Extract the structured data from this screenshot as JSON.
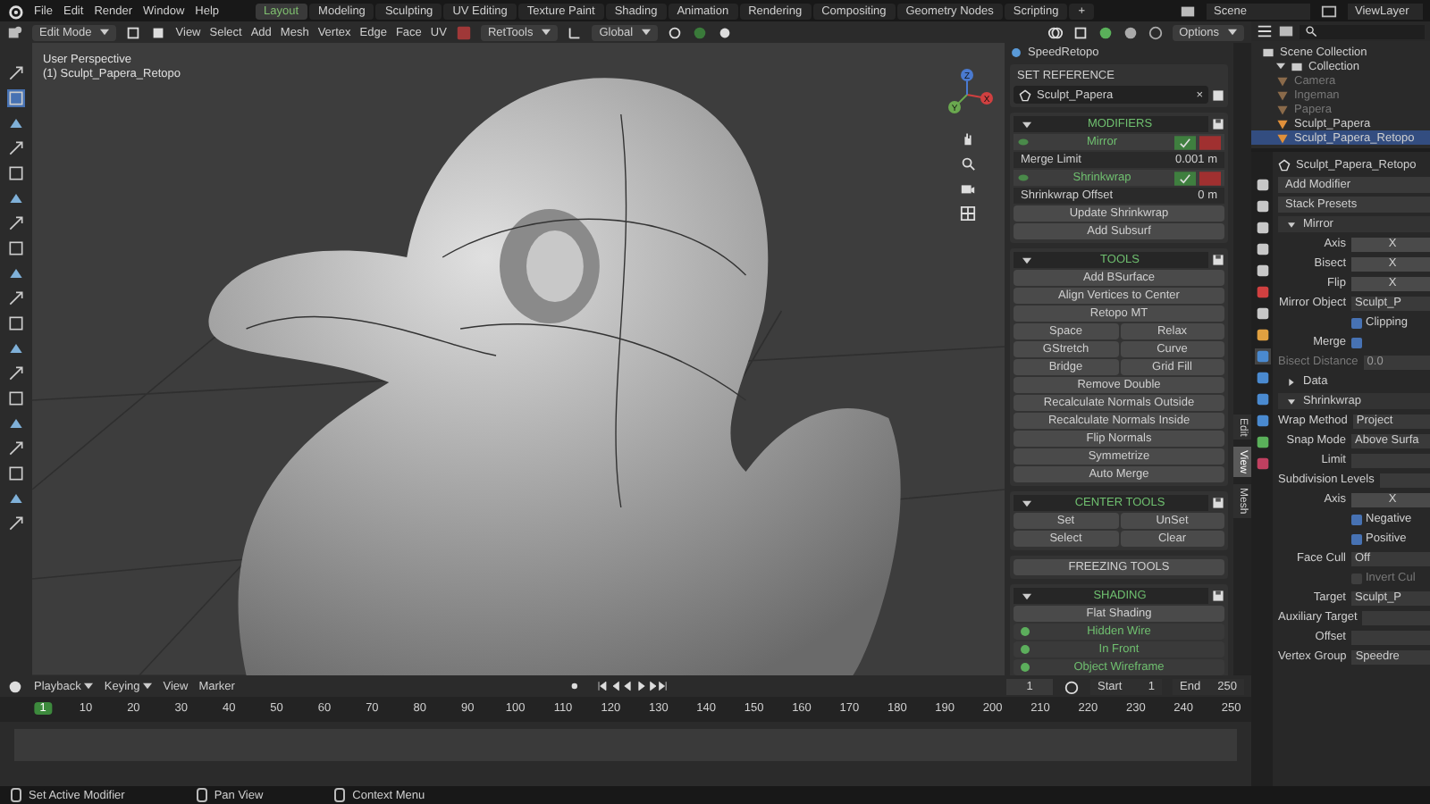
{
  "topbar": {
    "menus": [
      "File",
      "Edit",
      "Render",
      "Window",
      "Help"
    ],
    "workspaces": [
      {
        "label": "Layout",
        "selected": true
      },
      {
        "label": "Modeling",
        "selected": false
      },
      {
        "label": "Sculpting",
        "selected": false
      },
      {
        "label": "UV Editing",
        "selected": false
      },
      {
        "label": "Texture Paint",
        "selected": false
      },
      {
        "label": "Shading",
        "selected": false
      },
      {
        "label": "Animation",
        "selected": false
      },
      {
        "label": "Rendering",
        "selected": false
      },
      {
        "label": "Compositing",
        "selected": false
      },
      {
        "label": "Geometry Nodes",
        "selected": false
      },
      {
        "label": "Scripting",
        "selected": false
      }
    ],
    "add_tab": "+",
    "scene": "Scene",
    "view_layer": "ViewLayer"
  },
  "header": {
    "mode": "Edit Mode",
    "menus": [
      "View",
      "Select",
      "Add",
      "Mesh",
      "Vertex",
      "Edge",
      "Face",
      "UV"
    ],
    "addon": "RetTools",
    "orientation": "Global",
    "options": "Options"
  },
  "viewport": {
    "view_name": "User Perspective",
    "object_name": "(1) Sculpt_Papera_Retopo",
    "axes": [
      "X",
      "Y",
      "Z"
    ]
  },
  "npanel": {
    "title": "SpeedRetopo",
    "sections": [
      {
        "kind": "label",
        "title": "SET REFERENCE",
        "rows": [
          {
            "kind": "field",
            "text": "Sculpt_Papera",
            "clear": "×"
          }
        ]
      },
      {
        "kind": "group",
        "title": "MODIFIERS",
        "rows": [
          {
            "kind": "modifier",
            "text": "Mirror"
          },
          {
            "kind": "prop",
            "text": "Merge Limit",
            "value": "0.001 m"
          },
          {
            "kind": "modifier",
            "text": "Shrinkwrap"
          },
          {
            "kind": "prop",
            "text": "Shrinkwrap Offset",
            "value": "0 m"
          },
          {
            "kind": "button",
            "text": "Update Shrinkwrap"
          },
          {
            "kind": "button",
            "text": "Add Subsurf"
          }
        ]
      },
      {
        "kind": "group",
        "title": "TOOLS",
        "rows": [
          {
            "kind": "button",
            "text": "Add BSurface"
          },
          {
            "kind": "button",
            "text": "Align Vertices to Center"
          },
          {
            "kind": "button",
            "text": "Retopo MT"
          },
          {
            "kind": "pair",
            "text": "Space",
            "text2": "Relax"
          },
          {
            "kind": "pair",
            "text": "GStretch",
            "text2": "Curve"
          },
          {
            "kind": "pair",
            "text": "Bridge",
            "text2": "Grid Fill"
          },
          {
            "kind": "button",
            "text": "Remove Double"
          },
          {
            "kind": "button",
            "text": "Recalculate Normals Outside"
          },
          {
            "kind": "button",
            "text": "Recalculate Normals Inside"
          },
          {
            "kind": "button",
            "text": "Flip Normals"
          },
          {
            "kind": "button",
            "text": "Symmetrize"
          },
          {
            "kind": "button",
            "text": "Auto Merge"
          }
        ]
      },
      {
        "kind": "group",
        "title": "CENTER TOOLS",
        "rows": [
          {
            "kind": "pair",
            "text": "Set",
            "text2": "UnSet"
          },
          {
            "kind": "pair",
            "text": "Select",
            "text2": "Clear"
          }
        ]
      },
      {
        "kind": "button",
        "title": "FREEZING TOOLS"
      },
      {
        "kind": "group",
        "title": "SHADING",
        "rows": [
          {
            "kind": "button",
            "text": "Flat Shading"
          },
          {
            "kind": "toggle",
            "text": "Hidden Wire"
          },
          {
            "kind": "toggle",
            "text": "In Front"
          },
          {
            "kind": "toggle",
            "text": "Object Wireframe"
          }
        ]
      }
    ]
  },
  "npanel_tabs": [
    {
      "label": "Edit",
      "selected": false
    },
    {
      "label": "View",
      "selected": true
    },
    {
      "label": "Mesh",
      "selected": false
    }
  ],
  "outliner": {
    "root": "Scene Collection",
    "collection": "Collection",
    "items": [
      {
        "name": "Camera",
        "selected": false,
        "hidden": true
      },
      {
        "name": "Ingeman",
        "selected": false,
        "hidden": true
      },
      {
        "name": "Papera",
        "selected": false,
        "hidden": true
      },
      {
        "name": "Sculpt_Papera",
        "selected": false,
        "hidden": false
      },
      {
        "name": "Sculpt_Papera_Retopo",
        "selected": true,
        "hidden": false
      }
    ]
  },
  "properties": {
    "object": "Sculpt_Papera_Retopo",
    "rows": [
      {
        "kind": "action",
        "label": "Add Modifier"
      },
      {
        "kind": "action",
        "label": "Stack Presets"
      },
      {
        "kind": "modifier",
        "label": "Mirror",
        "expanded": true
      },
      {
        "kind": "axis",
        "label": "Axis",
        "value": "X"
      },
      {
        "kind": "axis",
        "label": "Bisect",
        "value": "X"
      },
      {
        "kind": "axis",
        "label": "Flip",
        "value": "X"
      },
      {
        "kind": "field",
        "label": "Mirror Object",
        "value": "Sculpt_P"
      },
      {
        "kind": "check",
        "label": "Clipping",
        "checked": true,
        "disabled": false
      },
      {
        "kind": "checkfield",
        "label": "Merge",
        "checked": true
      },
      {
        "kind": "dimfield",
        "label": "Bisect Distance",
        "value": "0.0"
      },
      {
        "kind": "subpanel",
        "label": "Data",
        "expanded": false
      },
      {
        "kind": "modifier",
        "label": "Shrinkwrap",
        "expanded": true
      },
      {
        "kind": "field",
        "label": "Wrap Method",
        "value": "Project"
      },
      {
        "kind": "field",
        "label": "Snap Mode",
        "value": "Above Surfa"
      },
      {
        "kind": "field",
        "label": "Limit"
      },
      {
        "kind": "field",
        "label": "Subdivision Levels"
      },
      {
        "kind": "axis",
        "label": "Axis",
        "value": "X"
      },
      {
        "kind": "check",
        "label": "Negative",
        "checked": true,
        "disabled": false
      },
      {
        "kind": "check",
        "label": "Positive",
        "checked": true,
        "disabled": false
      },
      {
        "kind": "field",
        "label": "Face Cull",
        "value": "Off"
      },
      {
        "kind": "check",
        "label": "Invert Cul",
        "checked": false,
        "disabled": true
      },
      {
        "kind": "field",
        "label": "Target",
        "value": "Sculpt_P"
      },
      {
        "kind": "field",
        "label": "Auxiliary Target"
      },
      {
        "kind": "field",
        "label": "Offset"
      },
      {
        "kind": "field",
        "label": "Vertex Group",
        "value": "Speedre"
      }
    ]
  },
  "timeline": {
    "menus": [
      "Playback",
      "Keying",
      "View",
      "Marker"
    ],
    "current_frame": "1",
    "start_label": "Start",
    "start": "1",
    "end_label": "End",
    "end": "250",
    "frames": [
      {
        "label": "1",
        "selected": true
      },
      {
        "label": "10",
        "selected": false
      },
      {
        "label": "20",
        "selected": false
      },
      {
        "label": "30",
        "selected": false
      },
      {
        "label": "40",
        "selected": false
      },
      {
        "label": "50",
        "selected": false
      },
      {
        "label": "60",
        "selected": false
      },
      {
        "label": "70",
        "selected": false
      },
      {
        "label": "80",
        "selected": false
      },
      {
        "label": "90",
        "selected": false
      },
      {
        "label": "100",
        "selected": false
      },
      {
        "label": "110",
        "selected": false
      },
      {
        "label": "120",
        "selected": false
      },
      {
        "label": "130",
        "selected": false
      },
      {
        "label": "140",
        "selected": false
      },
      {
        "label": "150",
        "selected": false
      },
      {
        "label": "160",
        "selected": false
      },
      {
        "label": "170",
        "selected": false
      },
      {
        "label": "180",
        "selected": false
      },
      {
        "label": "190",
        "selected": false
      },
      {
        "label": "200",
        "selected": false
      },
      {
        "label": "210",
        "selected": false
      },
      {
        "label": "220",
        "selected": false
      },
      {
        "label": "230",
        "selected": false
      },
      {
        "label": "240",
        "selected": false
      },
      {
        "label": "250",
        "selected": false
      }
    ]
  },
  "status_bar": [
    "Set Active Modifier",
    "Pan View",
    "Context Menu"
  ]
}
